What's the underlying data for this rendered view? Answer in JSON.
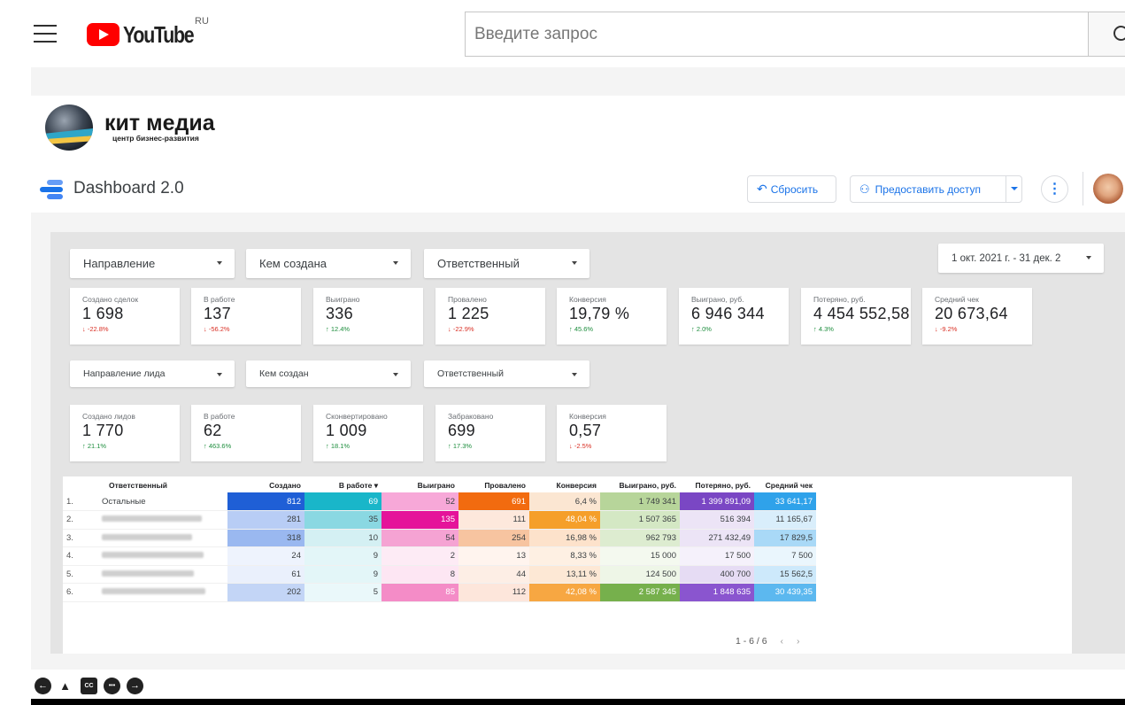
{
  "header": {
    "logo_text": "YouTube",
    "region": "RU",
    "search_placeholder": "Введите запрос"
  },
  "brand": {
    "name": "кит медиа",
    "tagline": "центр бизнес-развития"
  },
  "report": {
    "title": "Dashboard 2.0",
    "reset_label": "Сбросить",
    "share_label": "Предоставить доступ",
    "more_glyph": "⋮"
  },
  "filters_row1": [
    "Направление",
    "Кем создана",
    "Ответственный"
  ],
  "date_range": "1 окт. 2021 г. - 31 дек. 2",
  "kpi_deals": [
    {
      "label": "Создано сделок",
      "value": "1 698",
      "delta": "-22.8%",
      "dir": "down"
    },
    {
      "label": "В работе",
      "value": "137",
      "delta": "-56.2%",
      "dir": "down"
    },
    {
      "label": "Выиграно",
      "value": "336",
      "delta": "12.4%",
      "dir": "up"
    },
    {
      "label": "Провалено",
      "value": "1 225",
      "delta": "-22.9%",
      "dir": "down"
    },
    {
      "label": "Конверсия",
      "value": "19,79 %",
      "delta": "45.6%",
      "dir": "up"
    },
    {
      "label": "Выиграно, руб.",
      "value": "6 946 344",
      "delta": "2.0%",
      "dir": "up"
    },
    {
      "label": "Потеряно, руб.",
      "value": "4 454 552,58",
      "delta": "4.3%",
      "dir": "up"
    },
    {
      "label": "Средний чек",
      "value": "20 673,64",
      "delta": "-9.2%",
      "dir": "down"
    }
  ],
  "filters_row2": [
    "Направление лида",
    "Кем создан",
    "Ответственный"
  ],
  "kpi_leads": [
    {
      "label": "Создано лидов",
      "value": "1 770",
      "delta": "21.1%",
      "dir": "up"
    },
    {
      "label": "В работе",
      "value": "62",
      "delta": "463.6%",
      "dir": "up"
    },
    {
      "label": "Сконвертировано",
      "value": "1 009",
      "delta": "18.1%",
      "dir": "up"
    },
    {
      "label": "Забраковано",
      "value": "699",
      "delta": "17.3%",
      "dir": "up"
    },
    {
      "label": "Конверсия",
      "value": "0,57",
      "delta": "-2.5%",
      "dir": "down"
    }
  ],
  "table": {
    "headers": [
      "Ответственный",
      "Создано",
      "В работе ▾",
      "Выиграно",
      "Провалено",
      "Конверсия",
      "Выиграно, руб.",
      "Потеряно, руб.",
      "Средний чек"
    ],
    "rows": [
      {
        "idx": "1.",
        "name": "Остальные",
        "cells": [
          "812",
          "69",
          "52",
          "691",
          "6,4 %",
          "1 749 341",
          "1 399 891,09",
          "33 641,17"
        ]
      },
      {
        "idx": "2.",
        "name": "",
        "cells": [
          "281",
          "35",
          "135",
          "111",
          "48,04 %",
          "1 507 365",
          "516 394",
          "11 165,67"
        ]
      },
      {
        "idx": "3.",
        "name": "",
        "cells": [
          "318",
          "10",
          "54",
          "254",
          "16,98 %",
          "962 793",
          "271 432,49",
          "17 829,5"
        ]
      },
      {
        "idx": "4.",
        "name": "",
        "cells": [
          "24",
          "9",
          "2",
          "13",
          "8,33 %",
          "15 000",
          "17 500",
          "7 500"
        ]
      },
      {
        "idx": "5.",
        "name": "",
        "cells": [
          "61",
          "9",
          "8",
          "44",
          "13,11 %",
          "124 500",
          "400 700",
          "15 562,5"
        ]
      },
      {
        "idx": "6.",
        "name": "",
        "cells": [
          "202",
          "5",
          "85",
          "112",
          "42,08 %",
          "2 587 345",
          "1 848 635",
          "30 439,35"
        ]
      }
    ],
    "cell_colors": [
      [
        "#1f5fd6",
        "#19b6c9",
        "#f7a8d8",
        "#f26b0f",
        "#fbe6d2",
        "#b7d59a",
        "#7a47c4",
        "#2fa2ea"
      ],
      [
        "#b8cdf5",
        "#8ad8e2",
        "#e5139a",
        "#fde8dc",
        "#f59f2a",
        "#d4e8c4",
        "#ece4f6",
        "#d9eefb"
      ],
      [
        "#9ab8f0",
        "#d4f0f3",
        "#f5a3d3",
        "#f7c4a0",
        "#fde2cb",
        "#ddecd0",
        "#ece4f6",
        "#a9d9f7"
      ],
      [
        "#eef3fd",
        "#e3f6f8",
        "#fdebf5",
        "#fff4ee",
        "#fef0e3",
        "#f4f9ef",
        "#f5f1fb",
        "#eaf6fd"
      ],
      [
        "#eaf0fc",
        "#e3f6f8",
        "#fde6f3",
        "#fdeee5",
        "#fde8d5",
        "#eef6e7",
        "#e6dcf4",
        "#cde9fb"
      ],
      [
        "#c3d5f6",
        "#eaf8fa",
        "#f48cc7",
        "#fde6db",
        "#f7a742",
        "#76b04c",
        "#8a55cf",
        "#5cb8ef"
      ]
    ],
    "pager": "1 - 6 / 6"
  },
  "player_controls": [
    "←",
    "▲",
    "CC",
    "•••",
    "→"
  ]
}
